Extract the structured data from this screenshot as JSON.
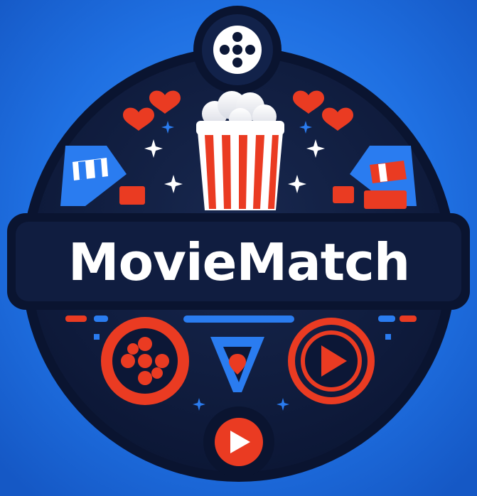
{
  "brand": {
    "name": "MovieMatch"
  },
  "colors": {
    "background": "#1e72e4",
    "badge_dark": "#0f1b3d",
    "badge_ring": "#0a1430",
    "accent_red": "#ea3b22",
    "accent_blue": "#2a7cf0",
    "text_white": "#ffffff"
  },
  "icons": [
    "film-reel-icon",
    "popcorn-icon",
    "heart-icon",
    "sparkle-icon",
    "ticket-icon",
    "location-pin-icon",
    "play-button-icon"
  ]
}
